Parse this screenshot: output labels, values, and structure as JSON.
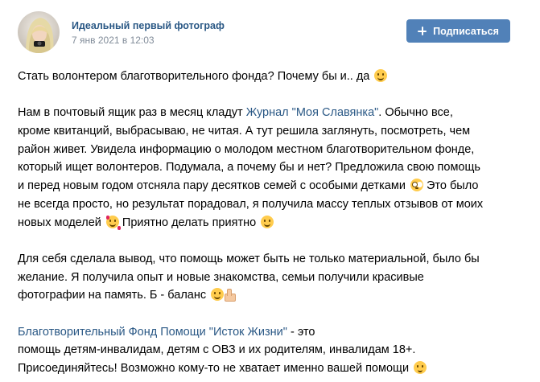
{
  "post": {
    "author": "Идеальный первый фотограф",
    "date": "7 янв 2021 в 12:03",
    "subscribe_label": "Подписаться",
    "avatar_icon": "user-avatar-photo",
    "link_color": "#2a5885",
    "button_color": "#5181b8",
    "text": {
      "l1": "Стать волонтером благотворительного фонда? Почему бы и.. да",
      "l2a": "Нам в почтовый ящик раз в месяц кладут ",
      "l2link": "Журнал \"Моя Славянка\"",
      "l2b": ". Обычно все,",
      "l3": "кроме квитанций, выбрасываю, не читая. А тут решила заглянуть, посмотреть, чем",
      "l4": "район живет. Увидела информацию о молодом местном благотворительном фонде,",
      "l5": "который ищет волонтеров. Подумала, а почему бы и нет? Предложила свою помощь",
      "l6a": "и перед новым годом отсняла пару десятков семей с особыми детками",
      "l6b": " Это было",
      "l7": "не всегда просто, но результат порадовал, я получила массу теплых отзывов от моих",
      "l8a": "новых моделей",
      "l8b": " Приятно делать приятно",
      "l9": "Для себя сделала вывод, что помощь может быть не только материальной, было бы",
      "l10": "желание. Я получила опыт и новые знакомства, семьи получили красивые",
      "l11": "фотографии на память. Б - баланс",
      "l12link": "Благотворительный Фонд Помощи \"Исток Жизни\"",
      "l12b": " - это",
      "l13": "помощь детям-инвалидам, детям с ОВЗ и их родителям, инвалидам 18+.",
      "l14": "Присоединяйтесь! Возможно кому-то не хватает именно вашей помощи"
    },
    "emojis": [
      "smiling-face-emoji",
      "flushed-face-emoji",
      "smiling-face-with-hearts-emoji",
      "smiling-face-emoji",
      "thumbs-up-emoji",
      "winking-face-emoji"
    ]
  }
}
